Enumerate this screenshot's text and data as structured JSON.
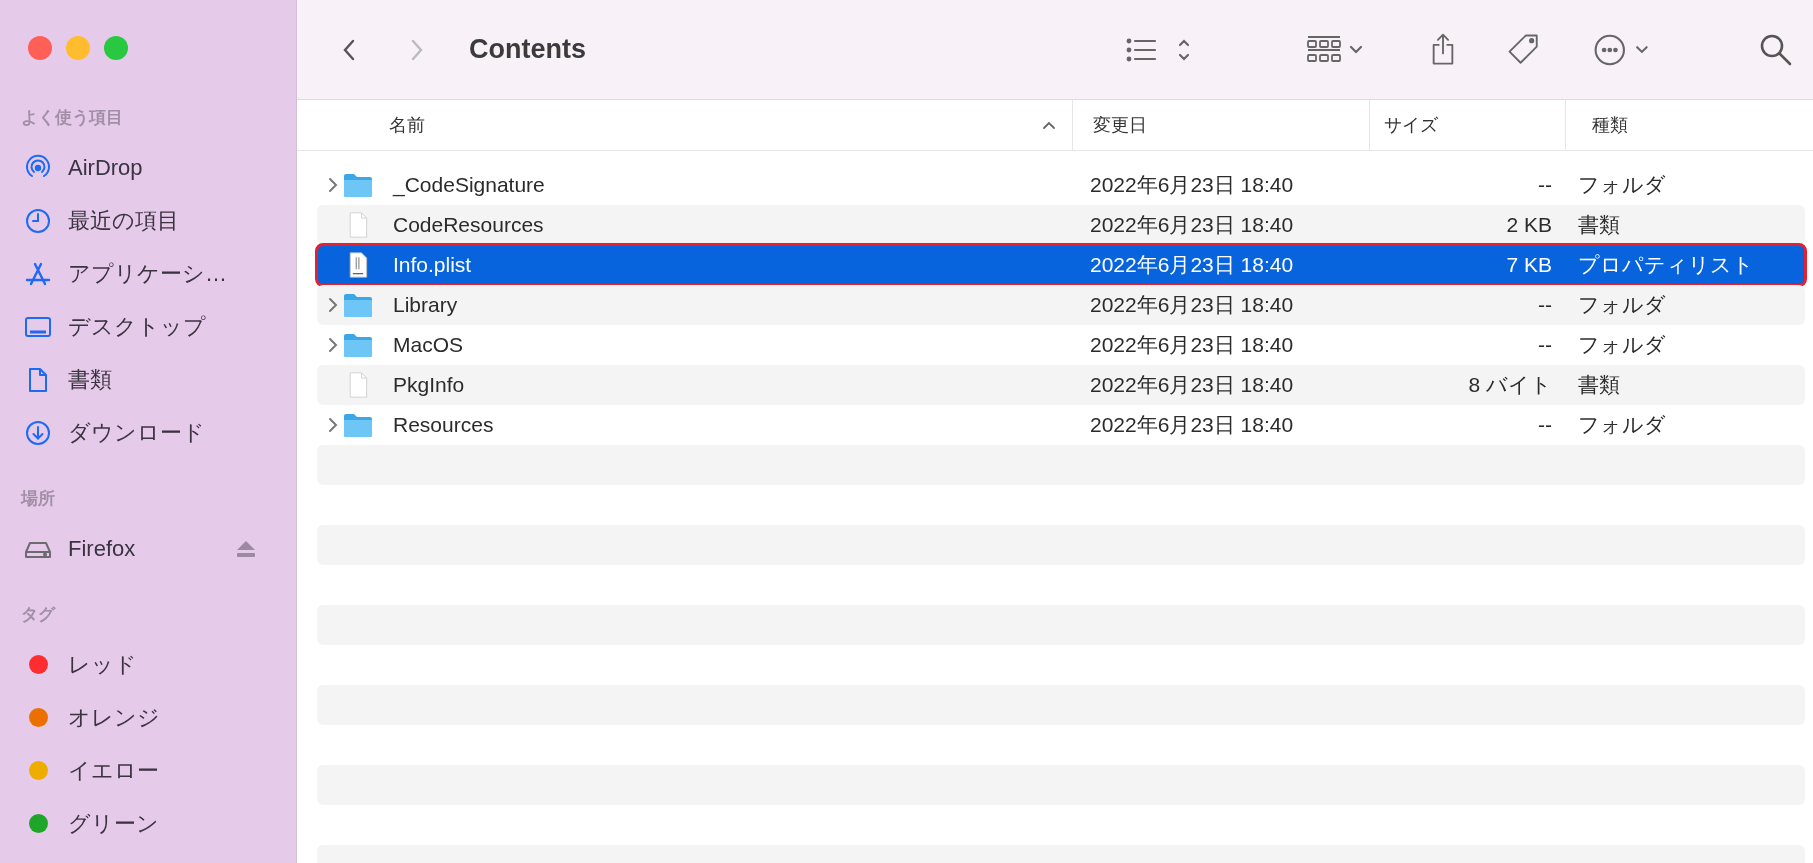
{
  "window": {
    "title": "Contents"
  },
  "sidebar": {
    "sections": [
      {
        "title": "よく使う項目",
        "items": [
          {
            "label": "AirDrop",
            "kind": "airdrop"
          },
          {
            "label": "最近の項目",
            "kind": "clock"
          },
          {
            "label": "アプリケーシ…",
            "kind": "apps"
          },
          {
            "label": "デスクトップ",
            "kind": "desktop"
          },
          {
            "label": "書類",
            "kind": "document"
          },
          {
            "label": "ダウンロード",
            "kind": "download"
          }
        ]
      },
      {
        "title": "場所",
        "items": [
          {
            "label": "Firefox",
            "kind": "disk"
          }
        ]
      },
      {
        "title": "タグ",
        "items": [
          {
            "label": "レッド",
            "kind": "tag",
            "color": "#fe2d30"
          },
          {
            "label": "オレンジ",
            "kind": "tag",
            "color": "#ec7000"
          },
          {
            "label": "イエロー",
            "kind": "tag",
            "color": "#eead00"
          },
          {
            "label": "グリーン",
            "kind": "tag",
            "color": "#1fa52a"
          }
        ]
      }
    ]
  },
  "table": {
    "columns": [
      {
        "label": "名前",
        "sorted": true
      },
      {
        "label": "変更日",
        "sorted": false
      },
      {
        "label": "サイズ",
        "sorted": false
      },
      {
        "label": "種類",
        "sorted": false
      }
    ],
    "rows": [
      {
        "name": "_CodeSignature",
        "kind": "folder",
        "date": "2022年6月23日 18:40",
        "size": "--",
        "type": "フォルダ",
        "selected": false
      },
      {
        "name": "CodeResources",
        "kind": "file",
        "date": "2022年6月23日 18:40",
        "size": "2 KB",
        "type": "書類",
        "selected": false
      },
      {
        "name": "Info.plist",
        "kind": "plist",
        "date": "2022年6月23日 18:40",
        "size": "7 KB",
        "type": "プロパティリスト",
        "selected": true
      },
      {
        "name": "Library",
        "kind": "folder",
        "date": "2022年6月23日 18:40",
        "size": "--",
        "type": "フォルダ",
        "selected": false
      },
      {
        "name": "MacOS",
        "kind": "folder",
        "date": "2022年6月23日 18:40",
        "size": "--",
        "type": "フォルダ",
        "selected": false
      },
      {
        "name": "PkgInfo",
        "kind": "file",
        "date": "2022年6月23日 18:40",
        "size": "8 バイト",
        "type": "書類",
        "selected": false
      },
      {
        "name": "Resources",
        "kind": "folder",
        "date": "2022年6月23日 18:40",
        "size": "--",
        "type": "フォルダ",
        "selected": false
      }
    ]
  }
}
